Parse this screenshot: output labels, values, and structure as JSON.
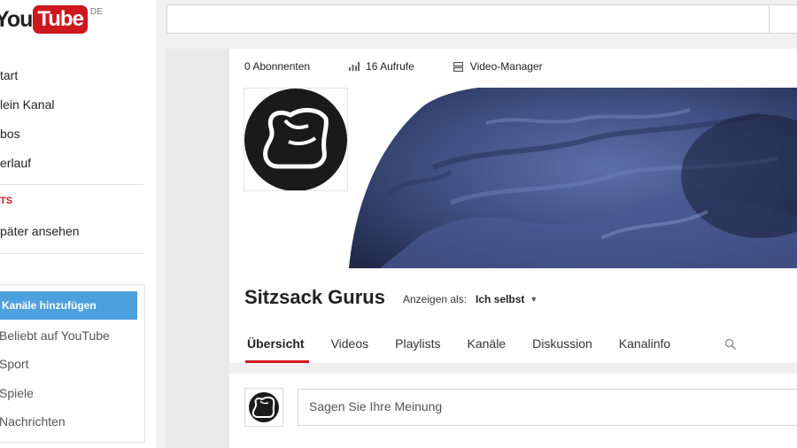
{
  "logo": {
    "you": "You",
    "tube": "Tube",
    "country": "DE"
  },
  "sidebar": {
    "items": [
      {
        "label": "tart"
      },
      {
        "label": "lein Kanal"
      },
      {
        "label": "bos"
      },
      {
        "label": "erlauf"
      }
    ],
    "heading": "TS",
    "watch_later": "päter ansehen"
  },
  "guide": {
    "add_channels": "Kanäle hinzufügen",
    "items": [
      {
        "label": "Beliebt auf YouTube"
      },
      {
        "label": "Sport"
      },
      {
        "label": "Spiele"
      },
      {
        "label": "Nachrichten"
      }
    ]
  },
  "search": {
    "value": ""
  },
  "channel": {
    "subscribers": "0 Abonnenten",
    "views": "16 Aufrufe",
    "video_manager": "Video-Manager",
    "name": "Sitzsack Gurus",
    "view_as_label": "Anzeigen als:",
    "view_as_value": "Ich selbst",
    "tabs": [
      {
        "label": "Übersicht",
        "active": true
      },
      {
        "label": "Videos",
        "active": false
      },
      {
        "label": "Playlists",
        "active": false
      },
      {
        "label": "Kanäle",
        "active": false
      },
      {
        "label": "Diskussion",
        "active": false
      },
      {
        "label": "Kanalinfo",
        "active": false
      }
    ]
  },
  "comment": {
    "placeholder": "Sagen Sie Ihre Meinung"
  },
  "colors": {
    "brand_red": "#cc181e",
    "accent_blue": "#4da0de",
    "banner_blue": "#3b4a78"
  }
}
